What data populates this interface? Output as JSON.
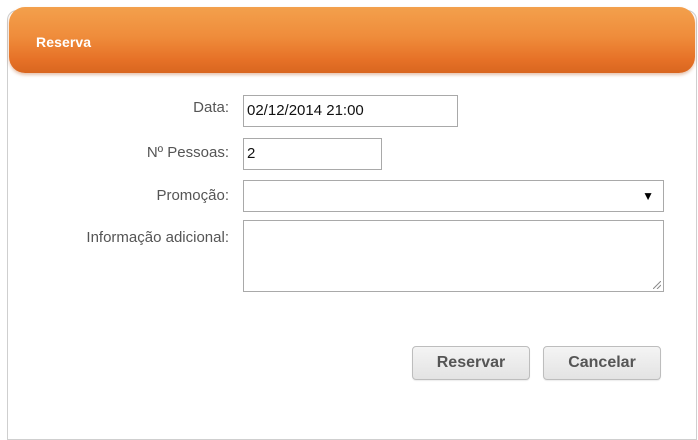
{
  "dialog": {
    "title": "Reserva",
    "header_color": "#e67127"
  },
  "form": {
    "data": {
      "label": "Data:",
      "value": "02/12/2014 21:00"
    },
    "pessoas": {
      "label": "Nº Pessoas:",
      "value": "2"
    },
    "promocao": {
      "label": "Promoção:",
      "value": "",
      "arrow_icon": "dropdown-arrow-icon"
    },
    "info": {
      "label": "Informação adicional:",
      "value": ""
    }
  },
  "buttons": {
    "reservar": "Reservar",
    "cancelar": "Cancelar"
  }
}
